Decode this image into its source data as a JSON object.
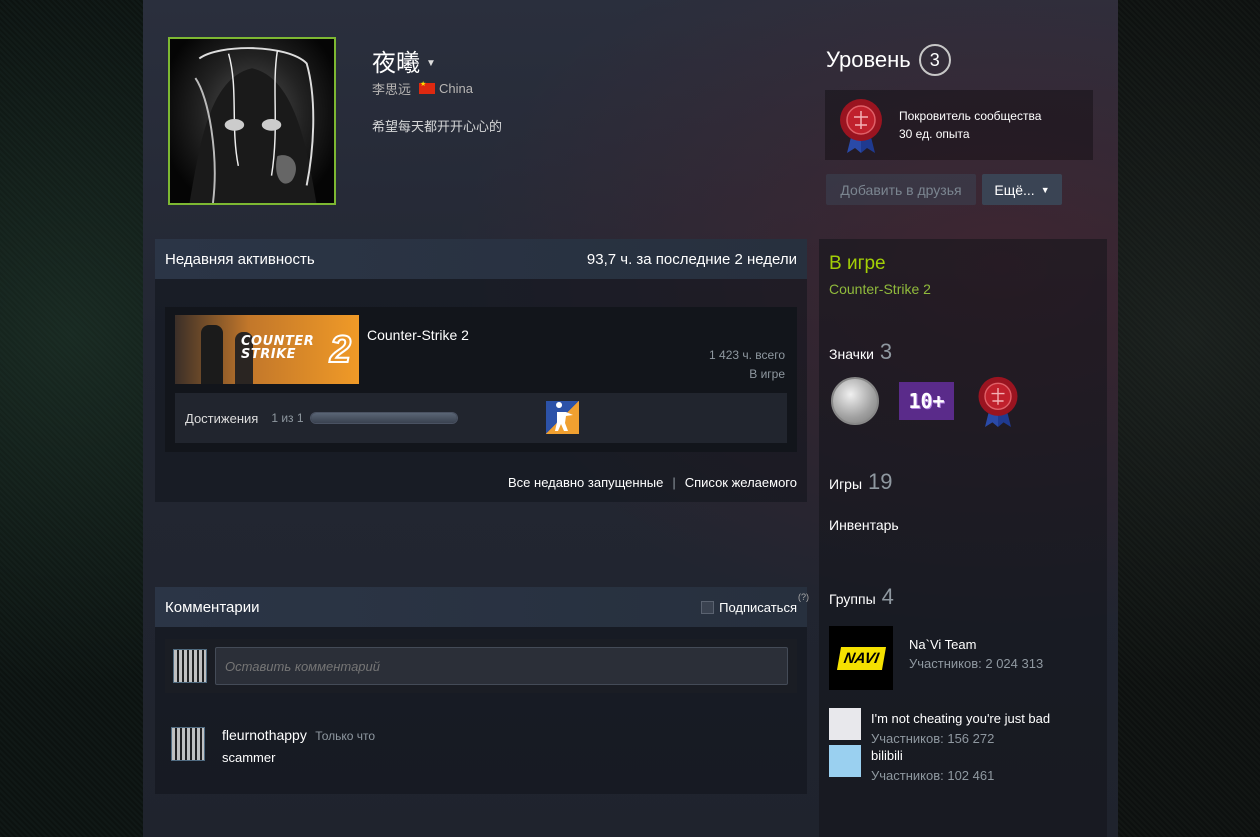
{
  "profile": {
    "persona_name": "夜曦",
    "real_name": "李思远",
    "country": "China",
    "summary": "希望每天都开开心心的"
  },
  "level": {
    "label": "Уровень",
    "value": "3"
  },
  "favorite_badge": {
    "name": "Покровитель сообщества",
    "xp": "30 ед. опыта"
  },
  "actions": {
    "add_friend": "Добавить в друзья",
    "more": "Ещё..."
  },
  "activity": {
    "title": "Недавняя активность",
    "hours_summary": "93,7 ч. за последние 2 недели",
    "game": {
      "name": "Counter-Strike 2",
      "capsule_logo": "COUNTER STRIKE",
      "capsule_number": "2",
      "total_hours": "1 423 ч. всего",
      "state": "В игре",
      "achievements_label": "Достижения",
      "achievements_count": "1 из 1",
      "achievements_progress": 1.0
    },
    "links": {
      "all_recent": "Все недавно запущенные",
      "separator": "|",
      "wishlist": "Список желаемого"
    }
  },
  "comments": {
    "title": "Комментарии",
    "subscribe_label": "Подписаться",
    "help": "(?)",
    "input_placeholder": "Оставить комментарий",
    "items": [
      {
        "author": "fleurnothappy",
        "time": "Только что",
        "text": "scammer"
      }
    ]
  },
  "sidebar": {
    "status": "В игре",
    "current_game": "Counter-Strike 2",
    "badges_label": "Значки",
    "badges_count": "3",
    "badge_ten_text": "10+",
    "games_label": "Игры",
    "games_count": "19",
    "inventory_label": "Инвентарь",
    "groups_label": "Группы",
    "groups_count": "4",
    "groups": [
      {
        "name": "Na`Vi Team",
        "members": "Участников: 2 024 313",
        "logo_text": "NAVI"
      },
      {
        "name": "I'm not cheating you're just bad",
        "members": "Участников: 156 272"
      },
      {
        "name": "bilibili",
        "members": "Участников: 102 461"
      }
    ]
  },
  "colors": {
    "accent_green": "#a3cf06",
    "avatar_border": "#7db832",
    "panel_head": "#2b3546"
  }
}
